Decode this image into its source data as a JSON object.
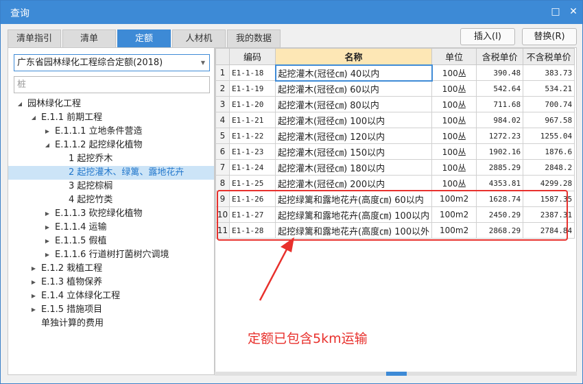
{
  "window": {
    "title": "查询",
    "minimize_icon": "□",
    "close_icon": "✕"
  },
  "tabs": [
    "清单指引",
    "清单",
    "定额",
    "人材机",
    "我的数据"
  ],
  "active_tab": "定额",
  "actions": {
    "insert_label": "插入(I)",
    "replace_label": "替换(R)"
  },
  "left": {
    "dropdown_value": "广东省园林绿化工程综合定额(2018)",
    "search_value": "桩",
    "tree": [
      {
        "label": "园林绿化工程",
        "level": 0,
        "arrow": "◢"
      },
      {
        "label": "E.1.1 前期工程",
        "level": 1,
        "arrow": "◢"
      },
      {
        "label": "E.1.1.1 立地条件营造",
        "level": 2,
        "arrow": "▶"
      },
      {
        "label": "E.1.1.2 起挖绿化植物",
        "level": 2,
        "arrow": "◢"
      },
      {
        "label": "1 起挖乔木",
        "level": 3,
        "arrow": ""
      },
      {
        "label": "2 起挖灌木、绿篱、露地花卉",
        "level": 3,
        "arrow": "",
        "selected": true
      },
      {
        "label": "3 起挖棕榈",
        "level": 3,
        "arrow": ""
      },
      {
        "label": "4 起挖竹类",
        "level": 3,
        "arrow": ""
      },
      {
        "label": "E.1.1.3 砍挖绿化植物",
        "level": 2,
        "arrow": "▶"
      },
      {
        "label": "E.1.1.4 运输",
        "level": 2,
        "arrow": "▶"
      },
      {
        "label": "E.1.1.5 假植",
        "level": 2,
        "arrow": "▶"
      },
      {
        "label": "E.1.1.6 行道树打菌树穴调境",
        "level": 2,
        "arrow": "▶"
      },
      {
        "label": "E.1.2 栽植工程",
        "level": 1,
        "arrow": "▶"
      },
      {
        "label": "E.1.3 植物保养",
        "level": 1,
        "arrow": "▶"
      },
      {
        "label": "E.1.4 立体绿化工程",
        "level": 1,
        "arrow": "▶"
      },
      {
        "label": "E.1.5 措施项目",
        "level": 1,
        "arrow": "▶"
      },
      {
        "label": "单独计算的费用",
        "level": 1,
        "arrow": ""
      }
    ]
  },
  "grid": {
    "headers": [
      "",
      "编码",
      "名称",
      "单位",
      "含税单价",
      "不含税单价"
    ],
    "rows": [
      [
        "1",
        "E1-1-18",
        "起挖灌木(冠径㎝) 40以内",
        "100丛",
        "390.48",
        "383.73"
      ],
      [
        "2",
        "E1-1-19",
        "起挖灌木(冠径㎝) 60以内",
        "100丛",
        "542.64",
        "534.21"
      ],
      [
        "3",
        "E1-1-20",
        "起挖灌木(冠径㎝) 80以内",
        "100丛",
        "711.68",
        "700.74"
      ],
      [
        "4",
        "E1-1-21",
        "起挖灌木(冠径㎝) 100以内",
        "100丛",
        "984.02",
        "967.58"
      ],
      [
        "5",
        "E1-1-22",
        "起挖灌木(冠径㎝) 120以内",
        "100丛",
        "1272.23",
        "1255.04"
      ],
      [
        "6",
        "E1-1-23",
        "起挖灌木(冠径㎝) 150以内",
        "100丛",
        "1902.16",
        "1876.6"
      ],
      [
        "7",
        "E1-1-24",
        "起挖灌木(冠径㎝) 180以内",
        "100丛",
        "2885.29",
        "2848.2"
      ],
      [
        "8",
        "E1-1-25",
        "起挖灌木(冠径㎝) 200以内",
        "100丛",
        "4353.81",
        "4299.28"
      ],
      [
        "9",
        "E1-1-26",
        "起挖绿篱和露地花卉(高度㎝) 60以内",
        "100m2",
        "1628.74",
        "1587.35"
      ],
      [
        "10",
        "E1-1-27",
        "起挖绿篱和露地花卉(高度㎝) 100以内",
        "100m2",
        "2450.29",
        "2387.31"
      ],
      [
        "11",
        "E1-1-28",
        "起挖绿篱和露地花卉(高度㎝) 100以外",
        "100m2",
        "2868.29",
        "2784.84"
      ]
    ]
  },
  "annotation": "定额已包含5km运输",
  "colors": {
    "accent": "#3d8ad6",
    "annotation_red": "#e8302c",
    "selected_row_bg": "#cce4f7",
    "name_header_bg": "#fde7b5"
  }
}
